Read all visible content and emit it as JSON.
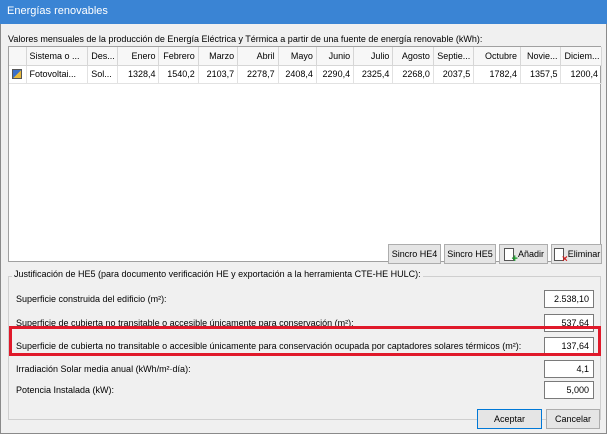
{
  "window": {
    "title": "Energías renovables"
  },
  "grid": {
    "label": "Valores mensuales de la producción de Energía Eléctrica y Térmica a partir de una fuente de energía renovable (kWh):",
    "columns": [
      "Sistema o ...",
      "Des...",
      "Enero",
      "Febrero",
      "Marzo",
      "Abril",
      "Mayo",
      "Junio",
      "Julio",
      "Agosto",
      "Septie...",
      "Octubre",
      "Novie...",
      "Diciem..."
    ],
    "rows": [
      {
        "icon": "solar-panel-icon",
        "cells": [
          "Fotovoltai...",
          "Sol...",
          "1328,4",
          "1540,2",
          "2103,7",
          "2278,7",
          "2408,4",
          "2290,4",
          "2325,4",
          "2268,0",
          "2037,5",
          "1782,4",
          "1357,5",
          "1200,4"
        ]
      }
    ]
  },
  "grid_buttons": {
    "sync_he4": "Sincro HE4",
    "sync_he5": "Sincro HE5",
    "add": "Añadir",
    "delete": "Eliminar"
  },
  "justification": {
    "title": "Justificación de HE5 (para documento verificación HE y exportación a la herramienta CTE-HE HULC):",
    "fields": [
      {
        "label": "Superficie construida del edificio (m²):",
        "value": "2.538,10"
      },
      {
        "label": "Superficie de cubierta no transitable o accesible únicamente para conservación (m²):",
        "value": "537,64"
      },
      {
        "label": "Superficie de cubierta no transitable o accesible únicamente para conservación ocupada por captadores solares térmicos (m²):",
        "value": "137,64"
      },
      {
        "label": "Irradiación Solar media anual (kWh/m²·día):",
        "value": "4,1"
      },
      {
        "label": "Potencia Instalada (kW):",
        "value": "5,000"
      }
    ]
  },
  "footer": {
    "accept": "Aceptar",
    "cancel": "Cancelar"
  },
  "colors": {
    "titlebar": "#3a84d4",
    "highlight": "#e0192a"
  }
}
